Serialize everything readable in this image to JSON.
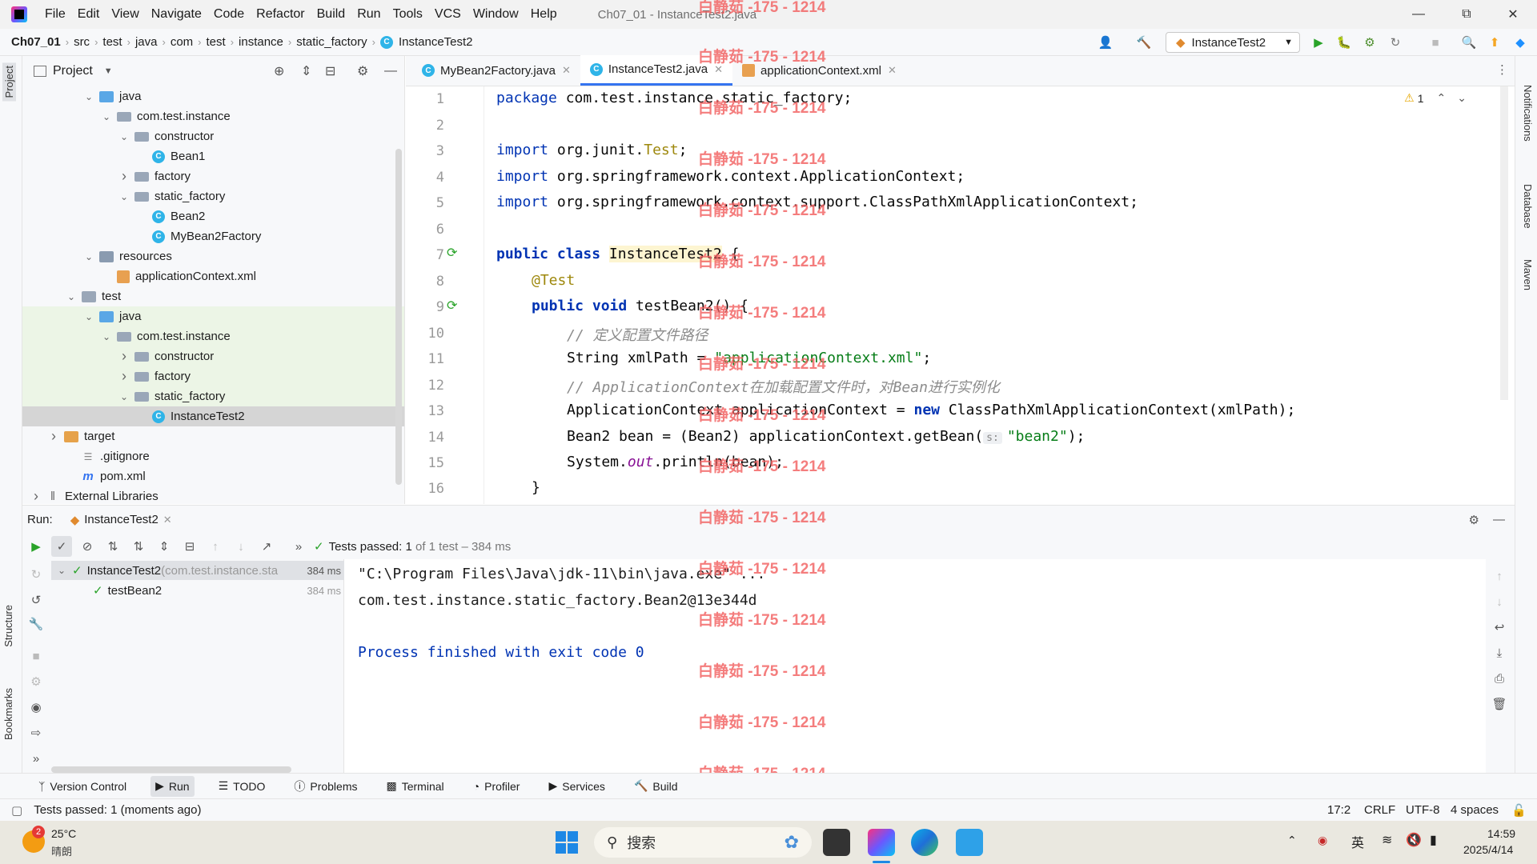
{
  "menubar": {
    "items": [
      "File",
      "Edit",
      "View",
      "Navigate",
      "Code",
      "Refactor",
      "Build",
      "Run",
      "Tools",
      "VCS",
      "Window",
      "Help"
    ],
    "window_title": "Ch07_01 - InstanceTest2.java"
  },
  "navbar": {
    "breadcrumbs": [
      "Ch07_01",
      "src",
      "test",
      "java",
      "com",
      "test",
      "instance",
      "static_factory",
      "InstanceTest2"
    ],
    "run_config": "InstanceTest2"
  },
  "left_strip": {
    "project": "Project",
    "structure": "Structure",
    "bookmarks": "Bookmarks"
  },
  "right_strip": {
    "notifications": "Notifications",
    "database": "Database",
    "maven": "Maven"
  },
  "project_panel": {
    "title": "Project",
    "tree": [
      {
        "label": "java",
        "type": "folder-blue",
        "depth": 3,
        "expanded": true
      },
      {
        "label": "com.test.instance",
        "type": "package",
        "depth": 4,
        "expanded": true
      },
      {
        "label": "constructor",
        "type": "package",
        "depth": 5,
        "expanded": true
      },
      {
        "label": "Bean1",
        "type": "class",
        "depth": 6
      },
      {
        "label": "factory",
        "type": "package",
        "depth": 5,
        "expanded": false
      },
      {
        "label": "static_factory",
        "type": "package",
        "depth": 5,
        "expanded": true
      },
      {
        "label": "Bean2",
        "type": "class",
        "depth": 6
      },
      {
        "label": "MyBean2Factory",
        "type": "class",
        "depth": 6
      },
      {
        "label": "resources",
        "type": "folder-res",
        "depth": 3,
        "expanded": true
      },
      {
        "label": "applicationContext.xml",
        "type": "xml",
        "depth": 4
      },
      {
        "label": "test",
        "type": "folder",
        "depth": 2,
        "expanded": true
      },
      {
        "label": "java",
        "type": "folder-blue",
        "depth": 3,
        "expanded": true,
        "green": true
      },
      {
        "label": "com.test.instance",
        "type": "package",
        "depth": 4,
        "expanded": true,
        "green": true
      },
      {
        "label": "constructor",
        "type": "package",
        "depth": 5,
        "expanded": false,
        "green": true
      },
      {
        "label": "factory",
        "type": "package",
        "depth": 5,
        "expanded": false,
        "green": true
      },
      {
        "label": "static_factory",
        "type": "package",
        "depth": 5,
        "expanded": true,
        "green": true
      },
      {
        "label": "InstanceTest2",
        "type": "class",
        "depth": 6,
        "selected": true
      },
      {
        "label": "target",
        "type": "folder-orange",
        "depth": 1,
        "expanded": false
      },
      {
        "label": ".gitignore",
        "type": "file",
        "depth": 2
      },
      {
        "label": "pom.xml",
        "type": "maven",
        "depth": 2
      },
      {
        "label": "External Libraries",
        "type": "lib",
        "depth": 0,
        "expanded": false
      }
    ]
  },
  "editor": {
    "tabs": [
      {
        "label": "MyBean2Factory.java",
        "active": false
      },
      {
        "label": "InstanceTest2.java",
        "active": true
      },
      {
        "label": "applicationContext.xml",
        "active": false
      }
    ],
    "warning_count": "1",
    "line_numbers": [
      "1",
      "2",
      "3",
      "4",
      "5",
      "6",
      "7",
      "8",
      "9",
      "10",
      "11",
      "12",
      "13",
      "14",
      "15",
      "16"
    ],
    "code": {
      "l1_kw": "package",
      "l1_rest": " com.test.instance.static_factory;",
      "l3_kw": "import",
      "l3_rest": " org.junit.",
      "l3_ann": "Test",
      "l3_end": ";",
      "l4_kw": "import",
      "l4_rest": " org.springframework.context.ApplicationContext;",
      "l5_kw": "import",
      "l5_rest": " org.springframework.context.support.ClassPathXmlApplicationContext;",
      "l7_kw": "public class",
      "l7_cls": "InstanceTest2",
      "l7_end": " {",
      "l8_ann": "@Test",
      "l9_kw": "public void",
      "l9_rest": " testBean2() {",
      "l10_cmt": "// 定义配置文件路径",
      "l11_pre": "String xmlPath = ",
      "l11_str": "\"applicationContext.xml\"",
      "l11_end": ";",
      "l12_cmt": "// ApplicationContext在加载配置文件时，对Bean进行实例化",
      "l13_pre": "ApplicationContext applicationContext = ",
      "l13_kw": "new",
      "l13_rest": " ClassPathXmlApplicationContext(xmlPath);",
      "l14_pre": "Bean2 bean = (Bean2) applicationContext.getBean(",
      "l14_hint": "s:",
      "l14_str": "\"bean2\"",
      "l14_end": ");",
      "l15_pre": "System.",
      "l15_out": "out",
      "l15_rest": ".println(bean);",
      "l16": "}"
    }
  },
  "watermark": "白静茹 -175 - 1214",
  "run_panel": {
    "label": "Run:",
    "tab": "InstanceTest2",
    "result_bold": "Tests passed: 1",
    "result_rest": " of 1 test – 384 ms",
    "tests": [
      {
        "name": "InstanceTest2",
        "pkg": " (com.test.instance.sta",
        "time": "384 ms"
      },
      {
        "name": "testBean2",
        "time": "384 ms"
      }
    ],
    "console": [
      "\"C:\\Program Files\\Java\\jdk-11\\bin\\java.exe\" ...",
      "com.test.instance.static_factory.Bean2@13e344d",
      "",
      "Process finished with exit code 0"
    ]
  },
  "tool_strip": [
    "Version Control",
    "Run",
    "TODO",
    "Problems",
    "Terminal",
    "Profiler",
    "Services",
    "Build"
  ],
  "status_bar": {
    "message": "Tests passed: 1 (moments ago)",
    "position": "17:2",
    "line_sep": "CRLF",
    "encoding": "UTF-8",
    "indent": "4 spaces"
  },
  "taskbar": {
    "weather_temp": "25°C",
    "weather_desc": "晴朗",
    "weather_badge": "2",
    "search": "搜索",
    "ime": "英",
    "time": "14:59",
    "date": "2025/4/14"
  }
}
